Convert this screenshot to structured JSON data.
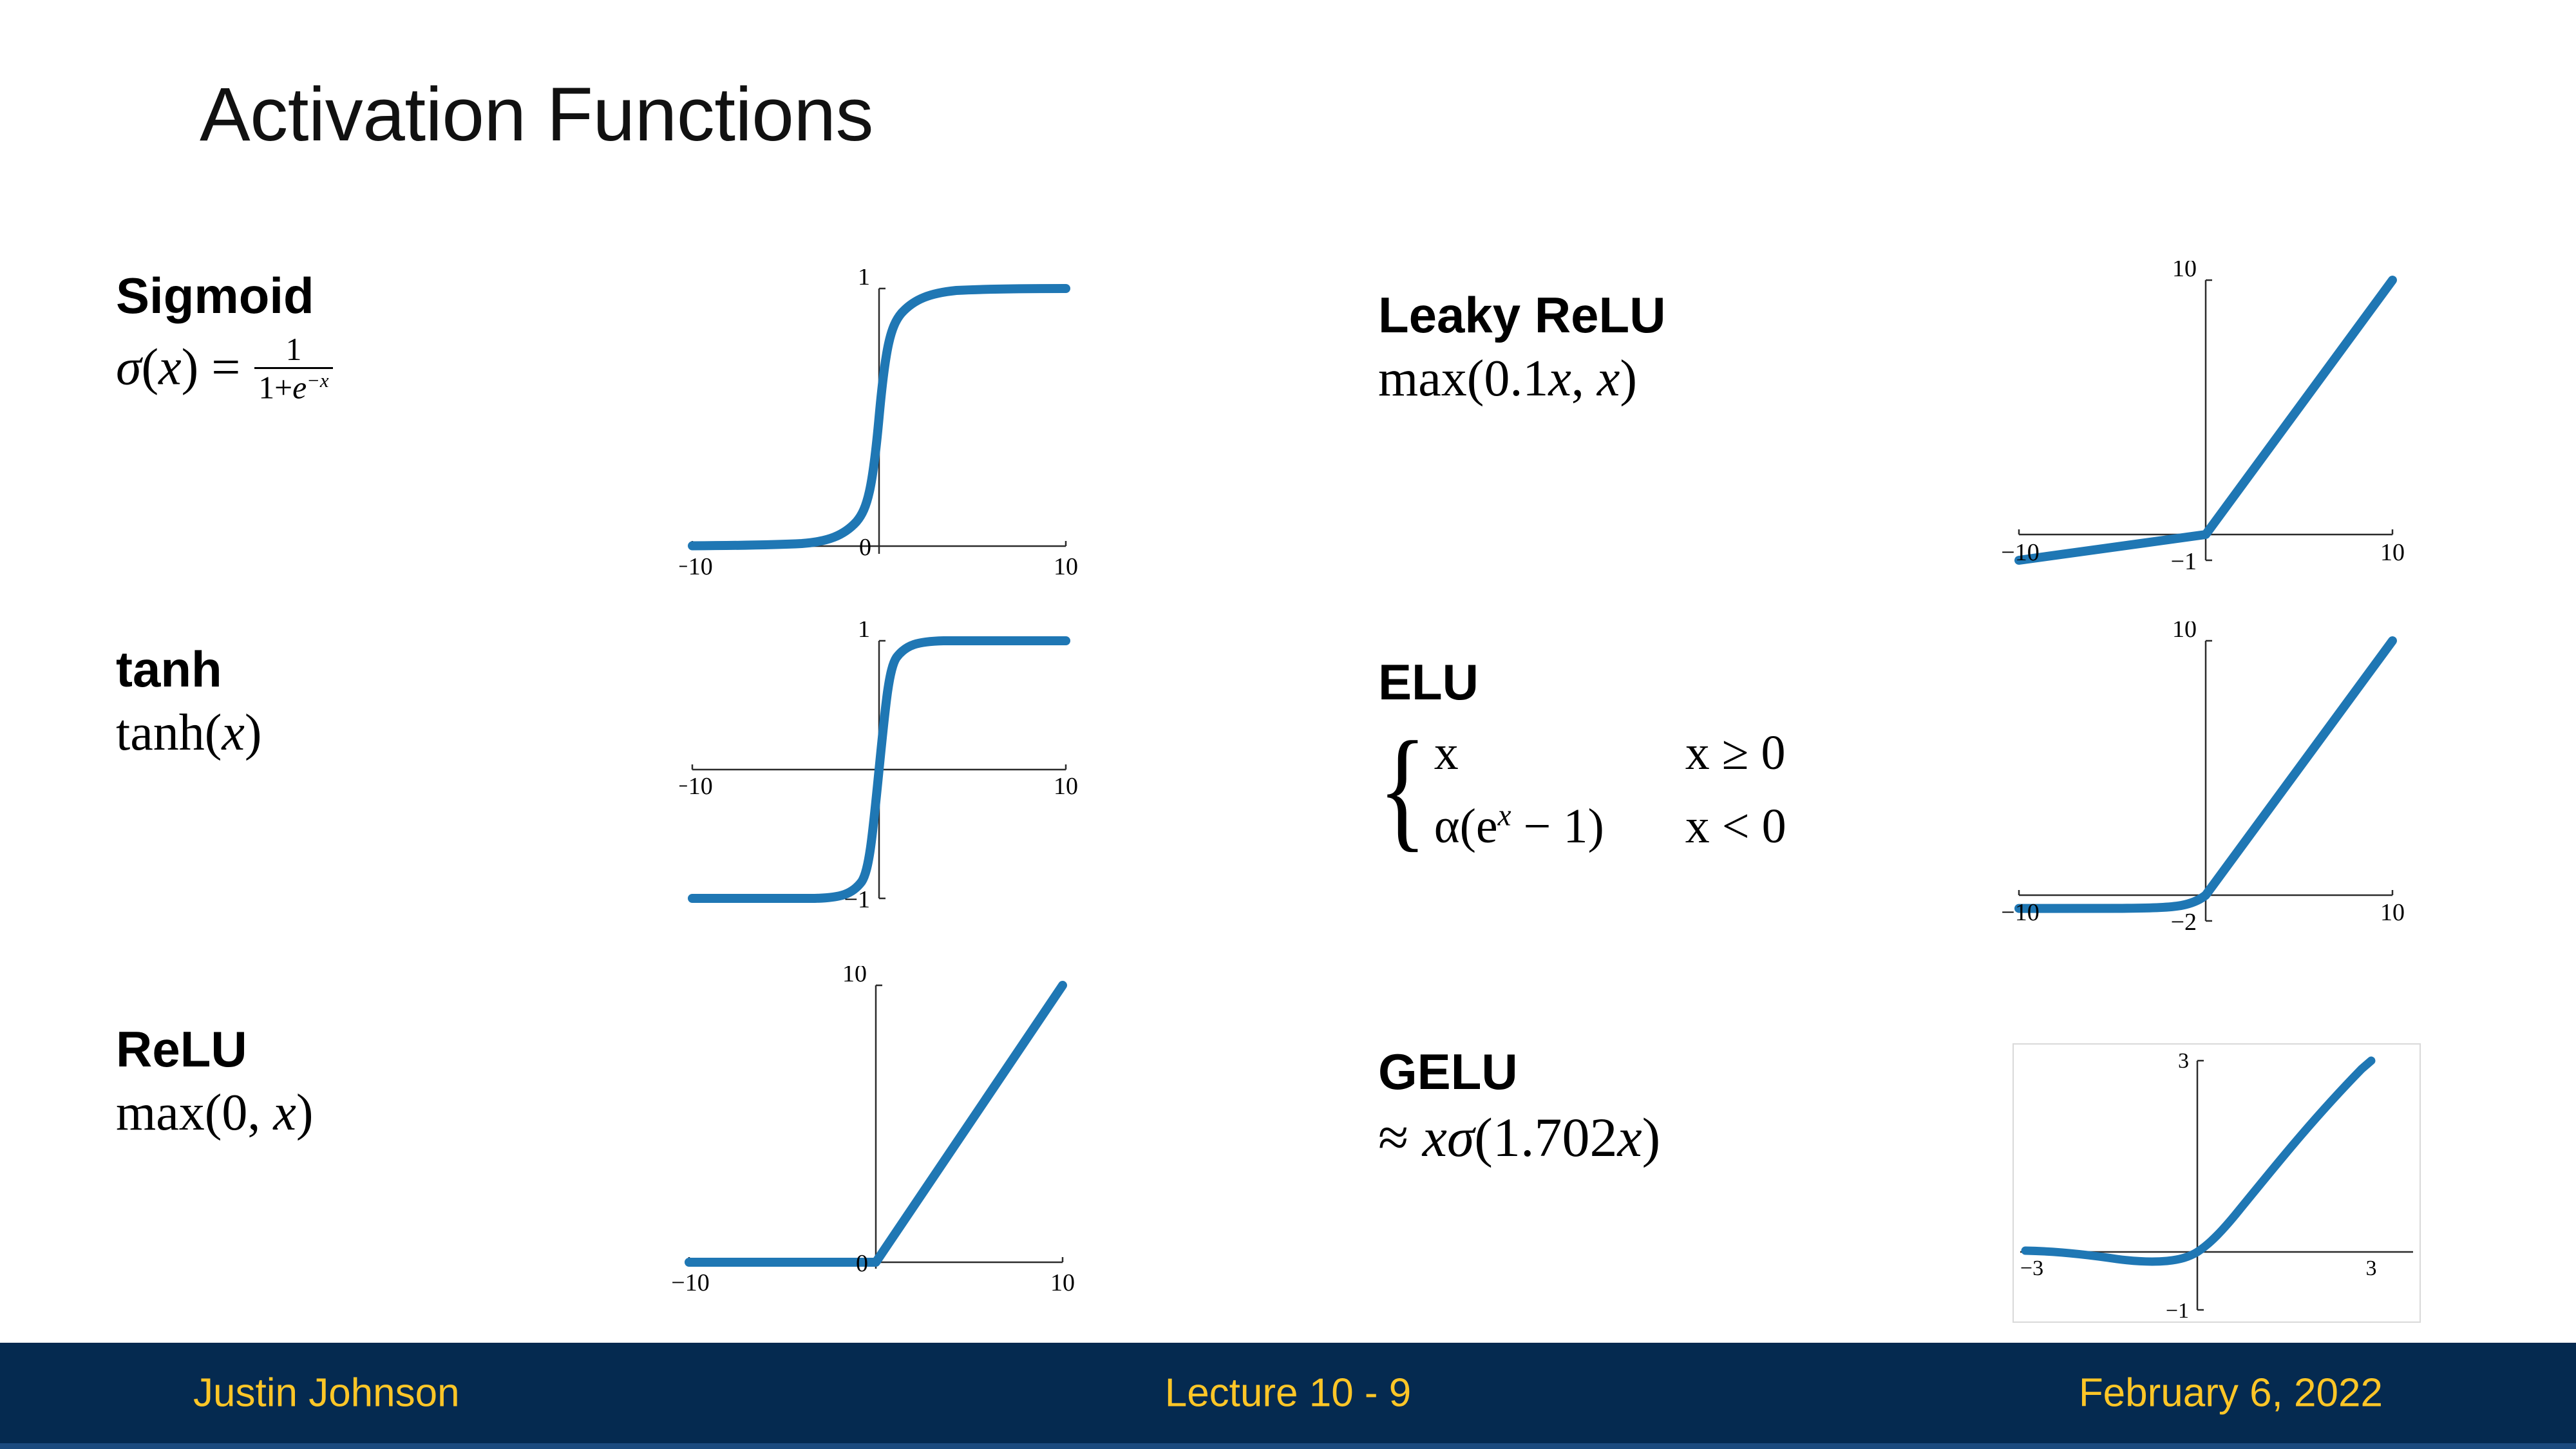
{
  "slide": {
    "title": "Activation Functions",
    "accent_navy": "#052A50",
    "accent_gold": "#FFC627",
    "curve_blue": "#1f77b4"
  },
  "footer": {
    "author": "Justin Johnson",
    "lecture": "Lecture 10 - 9",
    "date": "February 6, 2022"
  },
  "functions": {
    "sigmoid": {
      "name": "Sigmoid",
      "formula_sigma": "σ",
      "formula_open": "(",
      "formula_var": "x",
      "formula_close": ")",
      "formula_eq": "=",
      "frac_num": "1",
      "frac_den_a": "1+",
      "frac_den_e": "e",
      "frac_den_exp": "−x"
    },
    "tanh": {
      "name": "tanh",
      "formula": "tanh",
      "formula_open": "(",
      "formula_var": "x",
      "formula_close": ")"
    },
    "relu": {
      "name": "ReLU",
      "formula_fn": "max",
      "formula_open": "(",
      "formula_a": "0",
      "formula_comma": ",",
      "formula_b": "x",
      "formula_close": ")"
    },
    "leaky_relu": {
      "name": "Leaky ReLU",
      "formula_fn": "max",
      "formula_open": "(",
      "formula_a": "0.1",
      "formula_a_var": "x",
      "formula_comma": ",",
      "formula_b": "x",
      "formula_close": ")"
    },
    "elu": {
      "name": "ELU",
      "case1_lhs": "x",
      "case1_rhs": "x ≥ 0",
      "case2_lhs_alpha": "α",
      "case2_lhs_rest": "(e",
      "case2_lhs_exp": "x",
      "case2_lhs_tail": " − 1)",
      "case2_rhs": "x < 0"
    },
    "gelu": {
      "name": "GELU",
      "formula_approx": "≈",
      "formula_x": "x",
      "formula_sigma": "σ",
      "formula_open": "(",
      "formula_coef": "1.702",
      "formula_var": "x",
      "formula_close": ")"
    }
  },
  "chart_data": [
    {
      "id": "sigmoid-plot",
      "type": "line",
      "title": "Sigmoid",
      "expression": "1/(1+exp(-x))",
      "xlim": [
        -10,
        10
      ],
      "ylim": [
        0,
        1
      ],
      "xticks": [
        -10,
        10
      ],
      "xtick_labels": [
        "−10",
        "10"
      ],
      "yticks": [
        0,
        1
      ],
      "ytick_labels": [
        "0",
        "1"
      ],
      "grid": false,
      "legend": null,
      "line_color": "#1f77b4",
      "x": [
        -10,
        -9,
        -8,
        -7,
        -6,
        -5,
        -4,
        -3,
        -2,
        -1,
        0,
        1,
        2,
        3,
        4,
        5,
        6,
        7,
        8,
        9,
        10
      ],
      "y": [
        4.54e-05,
        0.000123,
        0.000335,
        0.000911,
        0.00247,
        0.00669,
        0.018,
        0.0474,
        0.1192,
        0.2689,
        0.5,
        0.7311,
        0.8808,
        0.9526,
        0.982,
        0.9933,
        0.9975,
        0.9991,
        0.9997,
        0.9999,
        0.99995
      ]
    },
    {
      "id": "tanh-plot",
      "type": "line",
      "title": "tanh",
      "expression": "tanh(x)",
      "xlim": [
        -10,
        10
      ],
      "ylim": [
        -1,
        1
      ],
      "xticks": [
        -10,
        10
      ],
      "xtick_labels": [
        "−10",
        "10"
      ],
      "yticks": [
        -1,
        1
      ],
      "ytick_labels": [
        "−1",
        "1"
      ],
      "grid": false,
      "legend": null,
      "line_color": "#1f77b4",
      "x": [
        -10,
        -8,
        -6,
        -4,
        -3,
        -2,
        -1.5,
        -1,
        -0.5,
        0,
        0.5,
        1,
        1.5,
        2,
        3,
        4,
        6,
        8,
        10
      ],
      "y": [
        -1.0,
        -1.0,
        -0.99999,
        -0.9993,
        -0.9951,
        -0.964,
        -0.9051,
        -0.7616,
        -0.4621,
        0,
        0.4621,
        0.7616,
        0.9051,
        0.964,
        0.9951,
        0.9993,
        0.99999,
        1.0,
        1.0
      ]
    },
    {
      "id": "relu-plot",
      "type": "line",
      "title": "ReLU",
      "expression": "max(0, x)",
      "xlim": [
        -10,
        10
      ],
      "ylim": [
        0,
        10
      ],
      "xticks": [
        -10,
        10
      ],
      "xtick_labels": [
        "−10",
        "10"
      ],
      "yticks": [
        0,
        10
      ],
      "ytick_labels": [
        "0",
        "10"
      ],
      "grid": false,
      "legend": null,
      "line_color": "#1f77b4",
      "x": [
        -10,
        0,
        10
      ],
      "y": [
        0,
        0,
        10
      ]
    },
    {
      "id": "leaky-relu-plot",
      "type": "line",
      "title": "Leaky ReLU",
      "expression": "max(0.1x, x)",
      "xlim": [
        -10,
        10
      ],
      "ylim": [
        -1,
        10
      ],
      "xticks": [
        -10,
        10
      ],
      "xtick_labels": [
        "−10",
        "10"
      ],
      "yticks": [
        -1,
        10
      ],
      "ytick_labels": [
        "−1",
        "10"
      ],
      "grid": false,
      "legend": null,
      "line_color": "#1f77b4",
      "x": [
        -10,
        0,
        10
      ],
      "y": [
        -1,
        0,
        10
      ]
    },
    {
      "id": "elu-plot",
      "type": "line",
      "title": "ELU",
      "expression": "x if x>=0 else alpha*(exp(x)-1)",
      "xlim": [
        -10,
        10
      ],
      "ylim": [
        -2,
        10
      ],
      "xticks": [
        -10,
        10
      ],
      "xtick_labels": [
        "−10",
        "10"
      ],
      "yticks": [
        -2,
        10
      ],
      "ytick_labels": [
        "−2",
        "10"
      ],
      "grid": false,
      "legend": null,
      "line_color": "#1f77b4",
      "x": [
        -10,
        -8,
        -6,
        -5,
        -4,
        -3,
        -2.5,
        -2,
        -1.5,
        -1,
        -0.5,
        0,
        2,
        4,
        6,
        8,
        10
      ],
      "y": [
        -1.0,
        -0.9997,
        -0.9975,
        -0.9933,
        -0.9817,
        -0.9502,
        -0.9179,
        -0.8647,
        -0.7769,
        -0.6321,
        -0.3935,
        0,
        2,
        4,
        6,
        8,
        10
      ]
    },
    {
      "id": "gelu-plot",
      "type": "line",
      "title": "GELU",
      "expression": "x*sigmoid(1.702x)",
      "xlim": [
        -3,
        3
      ],
      "ylim": [
        -1,
        3
      ],
      "xticks": [
        -3,
        3
      ],
      "xtick_labels": [
        "−3",
        "3"
      ],
      "yticks": [
        -1,
        3
      ],
      "ytick_labels": [
        "−1",
        "3"
      ],
      "grid": false,
      "boxed": true,
      "legend": null,
      "line_color": "#1f77b4",
      "x": [
        -3,
        -2.5,
        -2,
        -1.75,
        -1.5,
        -1.25,
        -1,
        -0.75,
        -0.5,
        -0.25,
        0,
        0.25,
        0.5,
        0.75,
        1,
        1.5,
        2,
        2.5,
        3
      ],
      "y": [
        -0.0182,
        -0.035,
        -0.0654,
        -0.0866,
        -0.1119,
        -0.1403,
        -0.1696,
        -0.1948,
        -0.2058,
        -0.1851,
        0,
        0.0649,
        0.2942,
        0.5552,
        0.8304,
        1.3881,
        1.9346,
        2.465,
        2.9818
      ]
    }
  ]
}
